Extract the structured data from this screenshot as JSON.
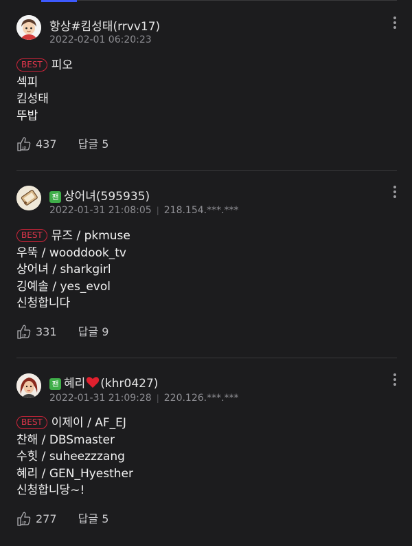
{
  "comments": [
    {
      "nickname": "항상#킴성태(rrvv17)",
      "fan": false,
      "date": "2022-02-01 06:20:23",
      "ip": "",
      "best_label": "BEST",
      "lines": [
        "피오",
        "섹피",
        "킴성태",
        "뚜밥"
      ],
      "likes": "437",
      "reply_label": "답글",
      "reply_count": "5"
    },
    {
      "nickname": "상어녀(595935)",
      "fan": true,
      "fan_label": "팬",
      "date": "2022-01-31 21:08:05",
      "ip": "218.154.***.***",
      "best_label": "BEST",
      "lines": [
        "뮤즈 / pkmuse",
        "우뚝 / wooddook_tv",
        "상어녀 / sharkgirl",
        "깅예솔 / yes_evol",
        "신청합니다"
      ],
      "likes": "331",
      "reply_label": "답글",
      "reply_count": "9"
    },
    {
      "nickname": "혜리",
      "nickname_suffix": "(khr0427)",
      "fan": true,
      "fan_label": "팬",
      "date": "2022-01-31 21:09:28",
      "ip": "220.126.***.***",
      "best_label": "BEST",
      "lines": [
        "이제이 / AF_EJ",
        "찬해 / DBSmaster",
        "수힛 / suheezzzang",
        "혜리 / GEN_Hyesther",
        "신청합니당~!"
      ],
      "likes": "277",
      "reply_label": "답글",
      "reply_count": "5"
    }
  ],
  "icons": {
    "like": "thumbs-up-icon",
    "more": "more-vertical-icon",
    "heart": "heart-icon"
  },
  "colors": {
    "best": "#d1243a",
    "fan_badge": "#3fae49",
    "heart": "#e0202e"
  }
}
